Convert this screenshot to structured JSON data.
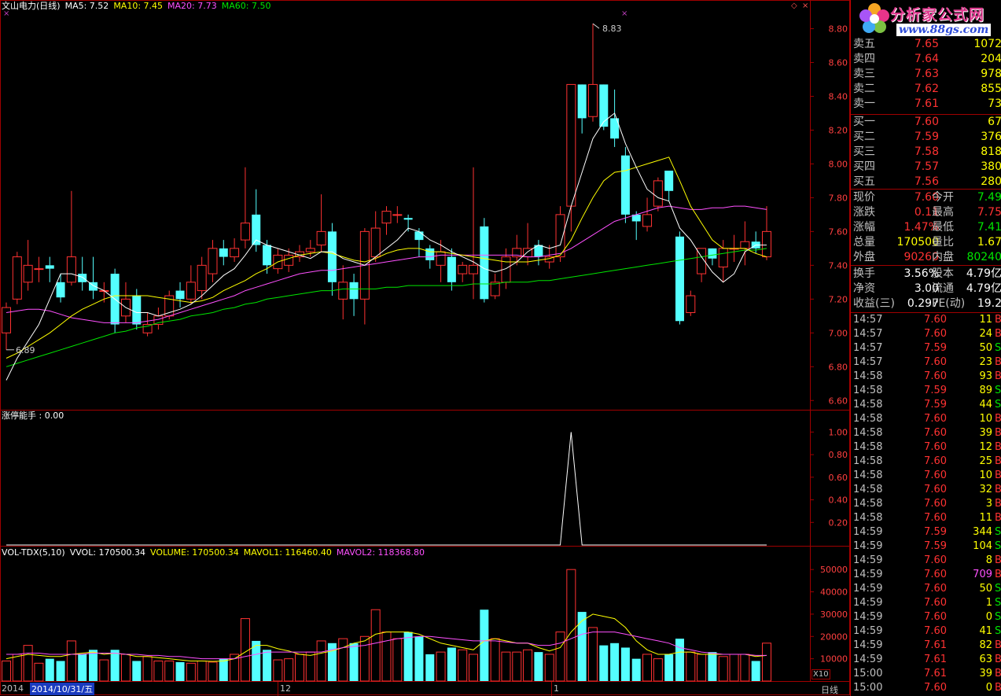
{
  "colors": {
    "up": "#ff3232",
    "down": "#54ffff",
    "ma5": "#ffffff",
    "ma10": "#ffff00",
    "ma20": "#ff50ff",
    "ma60": "#00e600",
    "grid": "#a00000"
  },
  "legend_main": {
    "title": "文山电力(日线)",
    "ma5": "MA5: 7.52",
    "ma10": "MA10: 7.45",
    "ma20": "MA20: 7.73",
    "ma60": "MA60: 7.50"
  },
  "legend_ind": {
    "title": "涨停能手 : 0.00"
  },
  "legend_vol": {
    "title": "VOL-TDX(5,10)",
    "vvol": "VVOL: 170500.34",
    "volume": "VOLUME: 170500.34",
    "mavol1": "MAVOL1: 116460.40",
    "mavol2": "MAVOL2: 118368.80"
  },
  "markers": {
    "high": "8.83",
    "low": "6.89"
  },
  "x_axis": {
    "left": "2014",
    "cursor_date": "2014/10/31/五",
    "m12": "12",
    "m1": "1",
    "period": "日线",
    "scale": "X10"
  },
  "axis_main": [
    "8.80",
    "8.60",
    "8.40",
    "8.20",
    "8.00",
    "7.80",
    "7.60",
    "7.40",
    "7.20",
    "7.00",
    "6.80",
    "6.60"
  ],
  "axis_ind": [
    "1.00",
    "0.80",
    "0.60",
    "0.40",
    "0.20"
  ],
  "axis_vol": [
    "50000",
    "40000",
    "30000",
    "20000",
    "10000"
  ],
  "logo": {
    "brand": "分析家公式网",
    "url": "www.88gs.com"
  },
  "quote": {
    "sell": [
      {
        "label": "卖五",
        "price": "7.65",
        "vol": "1072"
      },
      {
        "label": "卖四",
        "price": "7.64",
        "vol": "204"
      },
      {
        "label": "卖三",
        "price": "7.63",
        "vol": "978"
      },
      {
        "label": "卖二",
        "price": "7.62",
        "vol": "855"
      },
      {
        "label": "卖一",
        "price": "7.61",
        "vol": "73"
      }
    ],
    "buy": [
      {
        "label": "买一",
        "price": "7.60",
        "vol": "67"
      },
      {
        "label": "买二",
        "price": "7.59",
        "vol": "376"
      },
      {
        "label": "买三",
        "price": "7.58",
        "vol": "818"
      },
      {
        "label": "买四",
        "price": "7.57",
        "vol": "380"
      },
      {
        "label": "买五",
        "price": "7.56",
        "vol": "280"
      }
    ],
    "stats": [
      {
        "l1": "现价",
        "v1": "7.60",
        "l2": "今开",
        "v2": "7.49"
      },
      {
        "l1": "涨跌",
        "v1": "0.11",
        "l2": "最高",
        "v2": "7.75"
      },
      {
        "l1": "涨幅",
        "v1": "1.47%",
        "l2": "最低",
        "v2": "7.41"
      },
      {
        "l1": "总量",
        "v1": "170500",
        "l2": "量比",
        "v2": "1.67"
      },
      {
        "l1": "外盘",
        "v1": "90260",
        "l2": "内盘",
        "v2": "80240"
      }
    ],
    "stats2": [
      {
        "l1": "换手",
        "v1": "3.56%",
        "l2": "股本",
        "v2": "4.79亿"
      },
      {
        "l1": "净资",
        "v1": "3.00",
        "l2": "流通",
        "v2": "4.79亿"
      },
      {
        "l1": "收益(三)",
        "v1": "0.297",
        "l2": "PE(动)",
        "v2": "19.2"
      }
    ]
  },
  "ticks": [
    {
      "t": "14:57",
      "p": "7.60",
      "v": "11",
      "d": "B"
    },
    {
      "t": "14:57",
      "p": "7.60",
      "v": "24",
      "d": "B"
    },
    {
      "t": "14:57",
      "p": "7.59",
      "v": "50",
      "d": "S"
    },
    {
      "t": "14:57",
      "p": "7.60",
      "v": "23",
      "d": "B"
    },
    {
      "t": "14:58",
      "p": "7.60",
      "v": "93",
      "d": "B"
    },
    {
      "t": "14:58",
      "p": "7.59",
      "v": "89",
      "d": "S"
    },
    {
      "t": "14:58",
      "p": "7.59",
      "v": "44",
      "d": "S"
    },
    {
      "t": "14:58",
      "p": "7.60",
      "v": "10",
      "d": "B"
    },
    {
      "t": "14:58",
      "p": "7.60",
      "v": "39",
      "d": "B"
    },
    {
      "t": "14:58",
      "p": "7.60",
      "v": "12",
      "d": "B"
    },
    {
      "t": "14:58",
      "p": "7.60",
      "v": "25",
      "d": "B"
    },
    {
      "t": "14:58",
      "p": "7.60",
      "v": "10",
      "d": "B"
    },
    {
      "t": "14:58",
      "p": "7.60",
      "v": "32",
      "d": "B"
    },
    {
      "t": "14:58",
      "p": "7.60",
      "v": "3",
      "d": "B"
    },
    {
      "t": "14:58",
      "p": "7.60",
      "v": "11",
      "d": "B"
    },
    {
      "t": "14:59",
      "p": "7.59",
      "v": "344",
      "d": "S"
    },
    {
      "t": "14:59",
      "p": "7.59",
      "v": "104",
      "d": "S"
    },
    {
      "t": "14:59",
      "p": "7.60",
      "v": "8",
      "d": "B"
    },
    {
      "t": "14:59",
      "p": "7.60",
      "v": "709",
      "d": "B"
    },
    {
      "t": "14:59",
      "p": "7.60",
      "v": "50",
      "d": "S"
    },
    {
      "t": "14:59",
      "p": "7.60",
      "v": "1",
      "d": "S"
    },
    {
      "t": "14:59",
      "p": "7.60",
      "v": "0",
      "d": "S"
    },
    {
      "t": "14:59",
      "p": "7.60",
      "v": "41",
      "d": "S"
    },
    {
      "t": "14:59",
      "p": "7.61",
      "v": "82",
      "d": "B"
    },
    {
      "t": "14:59",
      "p": "7.61",
      "v": "63",
      "d": "B"
    },
    {
      "t": "15:00",
      "p": "7.61",
      "v": "39",
      "d": "B"
    },
    {
      "t": "15:00",
      "p": "7.60",
      "v": "0",
      "d": "B"
    }
  ],
  "chart_data": {
    "type": "candlestick",
    "price_ylim": [
      6.55,
      8.9
    ],
    "candles": [
      [
        7.0,
        7.15,
        7.18,
        6.9
      ],
      [
        7.2,
        7.45,
        7.48,
        7.17
      ],
      [
        7.3,
        7.4,
        7.55,
        7.25
      ],
      [
        7.38,
        7.38,
        7.45,
        7.3
      ],
      [
        7.4,
        7.38,
        7.45,
        7.3
      ],
      [
        7.3,
        7.21,
        7.35,
        7.18
      ],
      [
        7.3,
        7.45,
        7.84,
        7.28
      ],
      [
        7.35,
        7.3,
        7.45,
        7.25
      ],
      [
        7.3,
        7.25,
        7.45,
        7.2
      ],
      [
        7.25,
        7.25,
        7.3,
        7.18
      ],
      [
        7.35,
        7.05,
        7.38,
        7.0
      ],
      [
        7.1,
        7.2,
        7.3,
        7.06
      ],
      [
        7.22,
        7.05,
        7.26,
        7.02
      ],
      [
        7.0,
        7.05,
        7.12,
        6.98
      ],
      [
        7.05,
        7.1,
        7.15,
        7.02
      ],
      [
        7.1,
        7.22,
        7.25,
        7.08
      ],
      [
        7.25,
        7.2,
        7.3,
        7.15
      ],
      [
        7.2,
        7.3,
        7.4,
        7.17
      ],
      [
        7.25,
        7.4,
        7.45,
        7.2
      ],
      [
        7.35,
        7.5,
        7.55,
        7.3
      ],
      [
        7.5,
        7.45,
        7.55,
        7.4
      ],
      [
        7.45,
        7.5,
        7.56,
        7.42
      ],
      [
        7.55,
        7.65,
        7.98,
        7.5
      ],
      [
        7.7,
        7.52,
        7.85,
        7.48
      ],
      [
        7.52,
        7.4,
        7.55,
        7.35
      ],
      [
        7.38,
        7.46,
        7.5,
        7.35
      ],
      [
        7.4,
        7.46,
        7.5,
        7.36
      ],
      [
        7.45,
        7.48,
        7.52,
        7.42
      ],
      [
        7.48,
        7.5,
        7.55,
        7.45
      ],
      [
        7.52,
        7.6,
        7.82,
        7.48
      ],
      [
        7.6,
        7.3,
        7.65,
        7.22
      ],
      [
        7.2,
        7.3,
        7.4,
        7.08
      ],
      [
        7.3,
        7.2,
        7.35,
        7.1
      ],
      [
        7.2,
        7.6,
        7.62,
        7.05
      ],
      [
        7.45,
        7.62,
        7.72,
        7.42
      ],
      [
        7.65,
        7.72,
        7.75,
        7.58
      ],
      [
        7.7,
        7.7,
        7.75,
        7.65
      ],
      [
        7.68,
        7.67,
        7.7,
        7.6
      ],
      [
        7.6,
        7.55,
        7.62,
        7.45
      ],
      [
        7.5,
        7.43,
        7.52,
        7.38
      ],
      [
        7.4,
        7.48,
        7.55,
        7.3
      ],
      [
        7.45,
        7.3,
        7.5,
        7.25
      ],
      [
        7.35,
        7.4,
        7.42,
        7.3
      ],
      [
        7.35,
        7.4,
        7.98,
        7.2
      ],
      [
        7.63,
        7.2,
        7.68,
        7.18
      ],
      [
        7.22,
        7.3,
        7.35,
        7.2
      ],
      [
        7.3,
        7.45,
        7.5,
        7.26
      ],
      [
        7.45,
        7.5,
        7.58,
        7.4
      ],
      [
        7.45,
        7.5,
        7.65,
        7.4
      ],
      [
        7.52,
        7.45,
        7.55,
        7.4
      ],
      [
        7.42,
        7.45,
        7.52,
        7.38
      ],
      [
        7.45,
        7.7,
        7.75,
        7.42
      ],
      [
        7.75,
        8.47,
        8.47,
        7.6
      ],
      [
        8.47,
        8.27,
        8.47,
        8.18
      ],
      [
        8.28,
        8.47,
        8.83,
        8.25
      ],
      [
        8.47,
        8.22,
        8.47,
        8.2
      ],
      [
        8.27,
        8.15,
        8.44,
        8.1
      ],
      [
        8.05,
        7.7,
        8.1,
        7.65
      ],
      [
        7.7,
        7.66,
        7.72,
        7.55
      ],
      [
        7.63,
        7.7,
        7.8,
        7.6
      ],
      [
        7.75,
        7.9,
        7.92,
        7.72
      ],
      [
        7.96,
        7.84,
        7.96,
        7.78
      ],
      [
        7.57,
        7.07,
        7.6,
        7.05
      ],
      [
        7.12,
        7.22,
        7.25,
        7.1
      ],
      [
        7.35,
        7.5,
        7.5,
        7.3
      ],
      [
        7.5,
        7.44,
        7.5,
        7.4
      ],
      [
        7.39,
        7.5,
        7.55,
        7.3
      ],
      [
        7.5,
        7.5,
        7.58,
        7.42
      ],
      [
        7.5,
        7.54,
        7.66,
        7.4
      ],
      [
        7.54,
        7.5,
        7.6,
        7.47
      ],
      [
        7.45,
        7.6,
        7.75,
        7.43
      ]
    ],
    "ma5": [
      6.72,
      6.85,
      6.95,
      7.05,
      7.2,
      7.35,
      7.35,
      7.33,
      7.28,
      7.25,
      7.2,
      7.15,
      7.12,
      7.12,
      7.1,
      7.12,
      7.14,
      7.17,
      7.22,
      7.28,
      7.34,
      7.38,
      7.46,
      7.55,
      7.52,
      7.5,
      7.48,
      7.46,
      7.44,
      7.48,
      7.48,
      7.44,
      7.42,
      7.4,
      7.45,
      7.5,
      7.55,
      7.62,
      7.6,
      7.55,
      7.52,
      7.48,
      7.45,
      7.42,
      7.38,
      7.36,
      7.38,
      7.42,
      7.48,
      7.52,
      7.5,
      7.52,
      7.75,
      7.95,
      8.15,
      8.25,
      8.3,
      8.12,
      7.98,
      7.85,
      7.8,
      7.78,
      7.62,
      7.55,
      7.45,
      7.36,
      7.3,
      7.35,
      7.48,
      7.52,
      7.52
    ],
    "ma10": [
      6.85,
      6.88,
      6.92,
      6.96,
      7.0,
      7.05,
      7.1,
      7.14,
      7.17,
      7.2,
      7.22,
      7.22,
      7.22,
      7.22,
      7.21,
      7.2,
      7.19,
      7.18,
      7.19,
      7.21,
      7.25,
      7.28,
      7.31,
      7.35,
      7.38,
      7.42,
      7.44,
      7.46,
      7.47,
      7.48,
      7.47,
      7.45,
      7.43,
      7.42,
      7.44,
      7.47,
      7.49,
      7.5,
      7.5,
      7.48,
      7.48,
      7.47,
      7.46,
      7.45,
      7.44,
      7.43,
      7.42,
      7.42,
      7.42,
      7.43,
      7.44,
      7.46,
      7.55,
      7.68,
      7.8,
      7.9,
      7.95,
      7.96,
      7.98,
      8.0,
      8.02,
      8.04,
      7.9,
      7.75,
      7.65,
      7.55,
      7.5,
      7.5,
      7.5,
      7.47,
      7.45
    ],
    "ma20": [
      7.12,
      7.13,
      7.14,
      7.14,
      7.13,
      7.11,
      7.09,
      7.08,
      7.07,
      7.06,
      7.06,
      7.06,
      7.06,
      7.07,
      7.08,
      7.1,
      7.12,
      7.14,
      7.16,
      7.18,
      7.2,
      7.22,
      7.25,
      7.27,
      7.29,
      7.31,
      7.33,
      7.35,
      7.36,
      7.37,
      7.37,
      7.38,
      7.39,
      7.4,
      7.41,
      7.42,
      7.43,
      7.44,
      7.45,
      7.45,
      7.46,
      7.46,
      7.46,
      7.46,
      7.46,
      7.46,
      7.46,
      7.46,
      7.45,
      7.45,
      7.46,
      7.47,
      7.5,
      7.54,
      7.58,
      7.62,
      7.66,
      7.68,
      7.7,
      7.72,
      7.74,
      7.75,
      7.74,
      7.73,
      7.73,
      7.74,
      7.74,
      7.75,
      7.75,
      7.74,
      7.73
    ],
    "ma60": [
      6.8,
      6.82,
      6.84,
      6.86,
      6.88,
      6.9,
      6.92,
      6.94,
      6.96,
      6.98,
      7.0,
      7.01,
      7.03,
      7.04,
      7.06,
      7.07,
      7.08,
      7.1,
      7.11,
      7.12,
      7.14,
      7.15,
      7.17,
      7.18,
      7.2,
      7.21,
      7.22,
      7.23,
      7.24,
      7.25,
      7.25,
      7.26,
      7.26,
      7.26,
      7.26,
      7.27,
      7.27,
      7.28,
      7.28,
      7.28,
      7.28,
      7.28,
      7.28,
      7.29,
      7.29,
      7.29,
      7.3,
      7.3,
      7.3,
      7.31,
      7.31,
      7.32,
      7.33,
      7.34,
      7.35,
      7.36,
      7.37,
      7.38,
      7.39,
      7.4,
      7.41,
      7.42,
      7.43,
      7.44,
      7.45,
      7.46,
      7.47,
      7.48,
      7.49,
      7.49,
      7.5
    ],
    "indicator_ylim": [
      0,
      1.1
    ],
    "indicator": [
      0,
      0,
      0,
      0,
      0,
      0,
      0,
      0,
      0,
      0,
      0,
      0,
      0,
      0,
      0,
      0,
      0,
      0,
      0,
      0,
      0,
      0,
      0,
      0,
      0,
      0,
      0,
      0,
      0,
      0,
      0,
      0,
      0,
      0,
      0,
      0,
      0,
      0,
      0,
      0,
      0,
      0,
      0,
      0,
      0,
      0,
      0,
      0,
      0,
      0,
      0,
      0,
      1,
      0,
      0,
      0,
      0,
      0,
      0,
      0,
      0,
      0,
      0,
      0,
      0,
      0,
      0,
      0,
      0,
      0,
      0
    ],
    "volume_ylim": [
      0,
      55000
    ],
    "volume": [
      9000,
      12000,
      16000,
      8000,
      10000,
      9000,
      18000,
      12000,
      14000,
      9500,
      14000,
      12000,
      9000,
      11000,
      9000,
      9000,
      8500,
      8000,
      9000,
      8500,
      10000,
      12000,
      28000,
      18000,
      14000,
      9500,
      10000,
      12000,
      13000,
      18000,
      17000,
      19000,
      17000,
      20000,
      32000,
      22000,
      19000,
      22000,
      20000,
      12000,
      13000,
      15000,
      14000,
      12000,
      32000,
      19000,
      13000,
      13000,
      14000,
      13000,
      12000,
      22000,
      50000,
      31000,
      24000,
      16000,
      17000,
      15000,
      10000,
      12000,
      10000,
      12000,
      19000,
      13000,
      12000,
      13000,
      11000,
      12000,
      12000,
      9000,
      17000
    ],
    "mavol1": [
      10000,
      11000,
      12000,
      11500,
      11000,
      11000,
      12000,
      12500,
      13000,
      12000,
      12500,
      12000,
      11000,
      11000,
      10500,
      10000,
      9500,
      9000,
      9000,
      8800,
      9000,
      10000,
      13000,
      16000,
      16000,
      14500,
      13500,
      12000,
      11500,
      12500,
      13500,
      15000,
      17000,
      18000,
      21000,
      22000,
      22000,
      22000,
      21000,
      19000,
      17000,
      16000,
      15000,
      14000,
      18000,
      19000,
      18000,
      17000,
      17000,
      15000,
      13500,
      15000,
      22000,
      27000,
      30000,
      29000,
      28000,
      24000,
      18000,
      14000,
      12000,
      12000,
      13000,
      13000,
      12000,
      12000,
      12000,
      12000,
      12000,
      11000,
      11500
    ],
    "mavol2": [
      12000,
      12000,
      12500,
      12500,
      12000,
      12000,
      12000,
      12000,
      12500,
      12500,
      12500,
      12000,
      12000,
      11500,
      11500,
      11000,
      11000,
      10500,
      10000,
      10000,
      10000,
      10000,
      11000,
      12000,
      13000,
      13000,
      13000,
      13000,
      13000,
      13000,
      14000,
      15000,
      15500,
      16000,
      17000,
      18000,
      19000,
      19500,
      20000,
      20000,
      19500,
      19000,
      18500,
      18000,
      18000,
      18000,
      17500,
      17000,
      17000,
      16000,
      16000,
      17000,
      19000,
      21000,
      22000,
      22000,
      22000,
      21000,
      20000,
      19000,
      18000,
      17000,
      15000,
      14000,
      13000,
      12500,
      12000,
      12000,
      12000,
      11500,
      11500
    ]
  }
}
